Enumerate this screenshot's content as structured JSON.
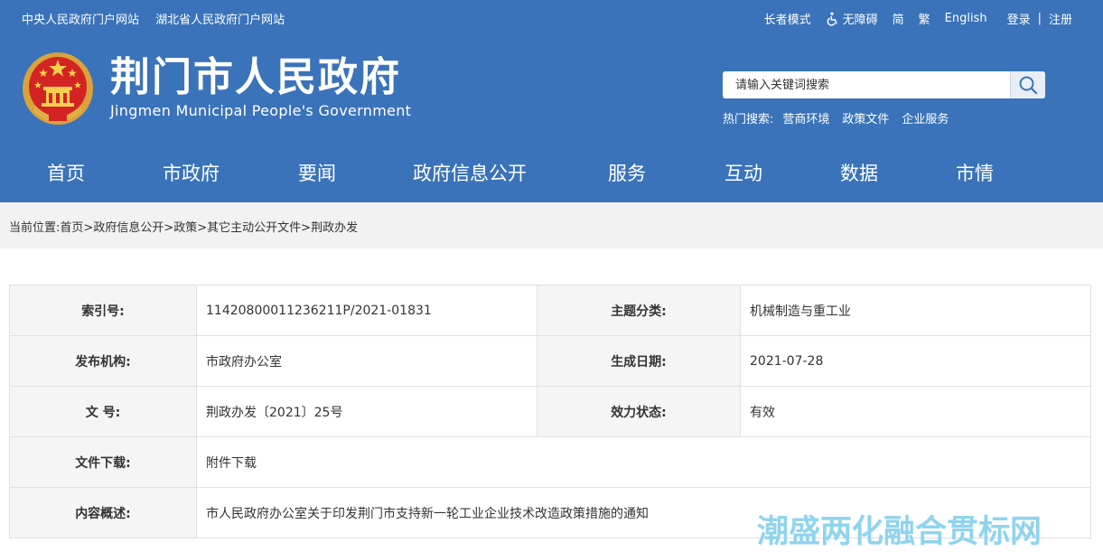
{
  "top_links": [
    "中央人民政府门户网站",
    "湖北省人民政府门户网站"
  ],
  "utility": {
    "elder_mode": "长者模式",
    "accessibility": "无障碍",
    "simplified": "简",
    "traditional": "繁",
    "english": "English",
    "login": "登录",
    "separator": "|",
    "register": "注册"
  },
  "site": {
    "title_cn": "荆门市人民政府",
    "title_en": "Jingmen Municipal People's Government"
  },
  "search": {
    "placeholder": "请输入关键词搜索",
    "hot_label": "热门搜索:",
    "hot_terms": [
      "营商环境",
      "政策文件",
      "企业服务"
    ]
  },
  "nav": [
    "首页",
    "市政府",
    "要闻",
    "政府信息公开",
    "服务",
    "互动",
    "数据",
    "市情"
  ],
  "breadcrumb": {
    "label": "当前位置:",
    "items": [
      "首页",
      "政府信息公开",
      "政策",
      "其它主动公开文件",
      "荆政办发"
    ],
    "sep": ">"
  },
  "doc_info": {
    "index_label": "索引号:",
    "index_value": "11420800011236211P/2021-01831",
    "topic_label": "主题分类:",
    "topic_value": "机械制造与重工业",
    "publisher_label": "发布机构:",
    "publisher_value": "市政府办公室",
    "date_label": "生成日期:",
    "date_value": "2021-07-28",
    "docno_label": "文 号:",
    "docno_value": "荆政办发〔2021〕25号",
    "status_label": "效力状态:",
    "status_value": "有效",
    "download_label": "文件下载:",
    "download_value": "附件下载",
    "summary_label": "内容概述:",
    "summary_value": "市人民政府办公室关于印发荆门市支持新一轮工业企业技术改造政策措施的通知"
  },
  "watermark": "潮盛两化融合贯标网",
  "colors": {
    "header_bg": "#3a73b9",
    "crumb_bg": "#f2f2f2",
    "label_bg": "#f5f5f5",
    "watermark": "#8fd4ef"
  }
}
